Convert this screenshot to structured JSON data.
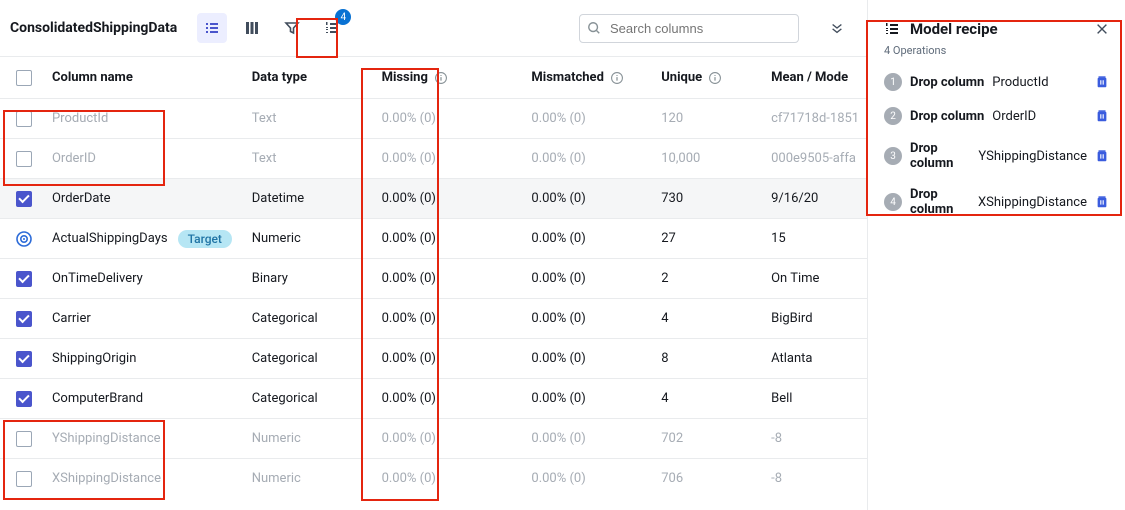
{
  "header": {
    "title": "ConsolidatedShippingData",
    "recipe_badge": "4",
    "search_placeholder": "Search columns"
  },
  "columns": {
    "name": "Column name",
    "type": "Data type",
    "missing": "Missing",
    "mismatched": "Mismatched",
    "unique": "Unique",
    "mean": "Mean / Mode"
  },
  "rows": [
    {
      "checked": false,
      "dropped": true,
      "target": false,
      "name": "ProductId",
      "type": "Text",
      "missing": "0.00% (0)",
      "mismatched": "0.00% (0)",
      "unique": "120",
      "mean": "cf71718d-1851"
    },
    {
      "checked": false,
      "dropped": true,
      "target": false,
      "name": "OrderID",
      "type": "Text",
      "missing": "0.00% (0)",
      "mismatched": "0.00% (0)",
      "unique": "10,000",
      "mean": "000e9505-affa"
    },
    {
      "checked": true,
      "dropped": false,
      "target": false,
      "name": "OrderDate",
      "type": "Datetime",
      "missing": "0.00% (0)",
      "mismatched": "0.00% (0)",
      "unique": "730",
      "mean": "9/16/20"
    },
    {
      "checked": false,
      "dropped": false,
      "target": true,
      "target_label": "Target",
      "name": "ActualShippingDays",
      "type": "Numeric",
      "missing": "0.00% (0)",
      "mismatched": "0.00% (0)",
      "unique": "27",
      "mean": "15"
    },
    {
      "checked": true,
      "dropped": false,
      "target": false,
      "name": "OnTimeDelivery",
      "type": "Binary",
      "missing": "0.00% (0)",
      "mismatched": "0.00% (0)",
      "unique": "2",
      "mean": "On Time"
    },
    {
      "checked": true,
      "dropped": false,
      "target": false,
      "name": "Carrier",
      "type": "Categorical",
      "missing": "0.00% (0)",
      "mismatched": "0.00% (0)",
      "unique": "4",
      "mean": "BigBird"
    },
    {
      "checked": true,
      "dropped": false,
      "target": false,
      "name": "ShippingOrigin",
      "type": "Categorical",
      "missing": "0.00% (0)",
      "mismatched": "0.00% (0)",
      "unique": "8",
      "mean": "Atlanta"
    },
    {
      "checked": true,
      "dropped": false,
      "target": false,
      "name": "ComputerBrand",
      "type": "Categorical",
      "missing": "0.00% (0)",
      "mismatched": "0.00% (0)",
      "unique": "4",
      "mean": "Bell"
    },
    {
      "checked": false,
      "dropped": true,
      "target": false,
      "name": "YShippingDistance",
      "type": "Numeric",
      "missing": "0.00% (0)",
      "mismatched": "0.00% (0)",
      "unique": "702",
      "mean": "-8"
    },
    {
      "checked": false,
      "dropped": true,
      "target": false,
      "name": "XShippingDistance",
      "type": "Numeric",
      "missing": "0.00% (0)",
      "mismatched": "0.00% (0)",
      "unique": "706",
      "mean": "-8"
    }
  ],
  "recipe": {
    "title": "Model recipe",
    "subtitle": "4 Operations",
    "ops": [
      {
        "n": "1",
        "op": "Drop column",
        "col": "ProductId"
      },
      {
        "n": "2",
        "op": "Drop column",
        "col": "OrderID"
      },
      {
        "n": "3",
        "op": "Drop column",
        "col": "YShippingDistance"
      },
      {
        "n": "4",
        "op": "Drop column",
        "col": "XShippingDistance"
      }
    ]
  }
}
